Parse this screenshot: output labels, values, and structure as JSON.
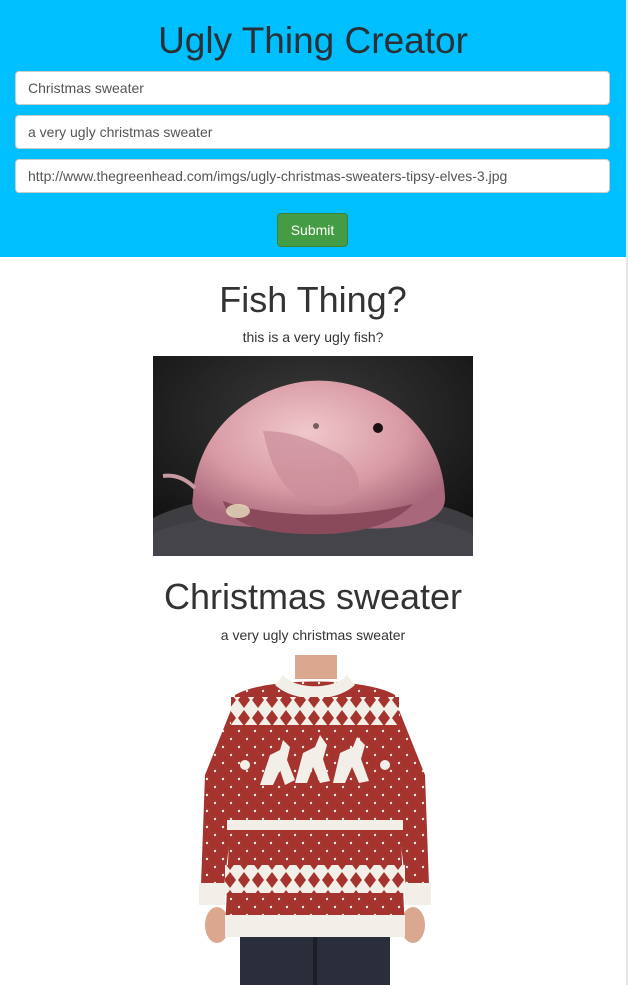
{
  "header": {
    "title": "Ugly Thing Creator",
    "bg_color": "#00bfff",
    "fields": [
      {
        "value": "Christmas sweater"
      },
      {
        "value": "a very ugly christmas sweater"
      },
      {
        "value": "http://www.thegreenhead.com/imgs/ugly-christmas-sweaters-tipsy-elves-3.jpg"
      }
    ],
    "submit_label": "Submit",
    "submit_color": "#449d44"
  },
  "things": [
    {
      "name": "Fish Thing?",
      "description": "this is a very ugly fish?",
      "image_subject": "blobfish"
    },
    {
      "name": "Christmas sweater",
      "description": "a very ugly christmas sweater",
      "image_subject": "red reindeer christmas sweater"
    }
  ]
}
